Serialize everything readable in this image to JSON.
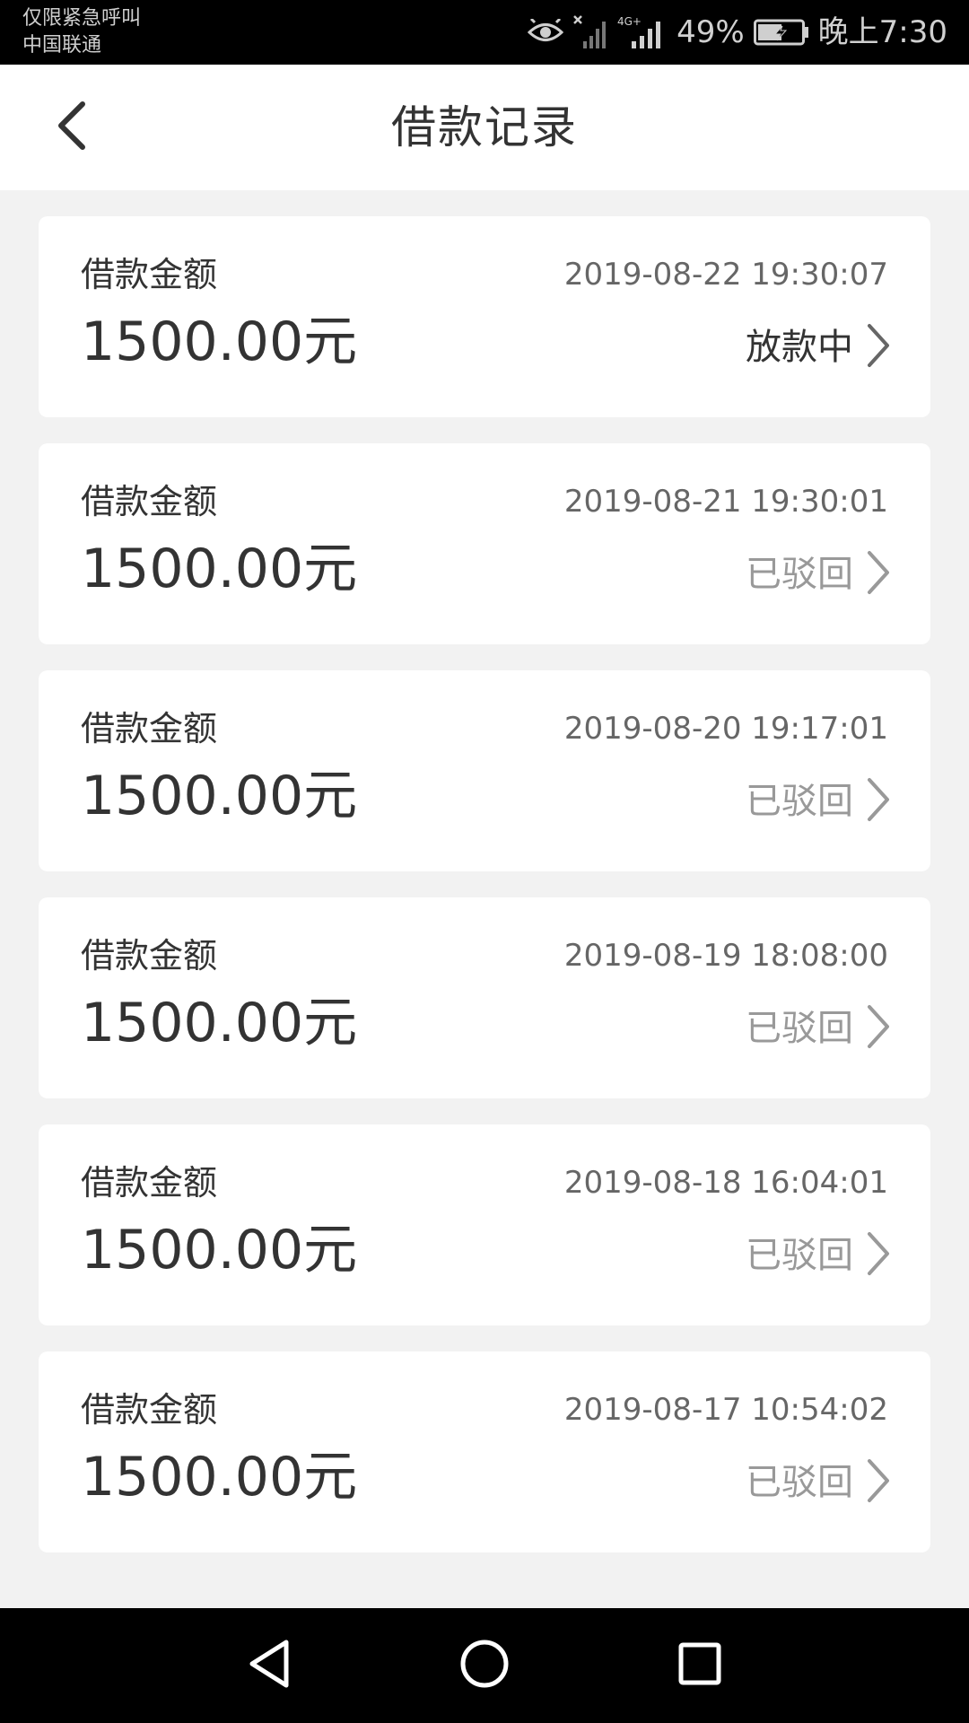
{
  "status_bar": {
    "carrier_line1": "仅限紧急呼叫",
    "carrier_line2": "中国联通",
    "network_label": "4G+",
    "battery": "49%",
    "time": "晚上7:30",
    "icons": [
      "eye-icon",
      "signal-no-sim-icon",
      "signal-4g-icon",
      "battery-charging-icon"
    ]
  },
  "header": {
    "title": "借款记录",
    "back_icon": "chevron-left-icon"
  },
  "records": [
    {
      "label": "借款金额",
      "amount": "1500.00元",
      "time": "2019-08-22 19:30:07",
      "status": "放款中"
    },
    {
      "label": "借款金额",
      "amount": "1500.00元",
      "time": "2019-08-21 19:30:01",
      "status": "已驳回"
    },
    {
      "label": "借款金额",
      "amount": "1500.00元",
      "time": "2019-08-20 19:17:01",
      "status": "已驳回"
    },
    {
      "label": "借款金额",
      "amount": "1500.00元",
      "time": "2019-08-19 18:08:00",
      "status": "已驳回"
    },
    {
      "label": "借款金额",
      "amount": "1500.00元",
      "time": "2019-08-18 16:04:01",
      "status": "已驳回"
    },
    {
      "label": "借款金额",
      "amount": "1500.00元",
      "time": "2019-08-17 10:54:02",
      "status": "已驳回"
    }
  ],
  "colors": {
    "background": "#f2f2f2",
    "card": "#ffffff",
    "text_primary": "#333333",
    "text_secondary": "#666666",
    "status_rejected": "#999999"
  },
  "nav_bar": {
    "icons": [
      "back-triangle-icon",
      "home-circle-icon",
      "recents-square-icon"
    ]
  }
}
